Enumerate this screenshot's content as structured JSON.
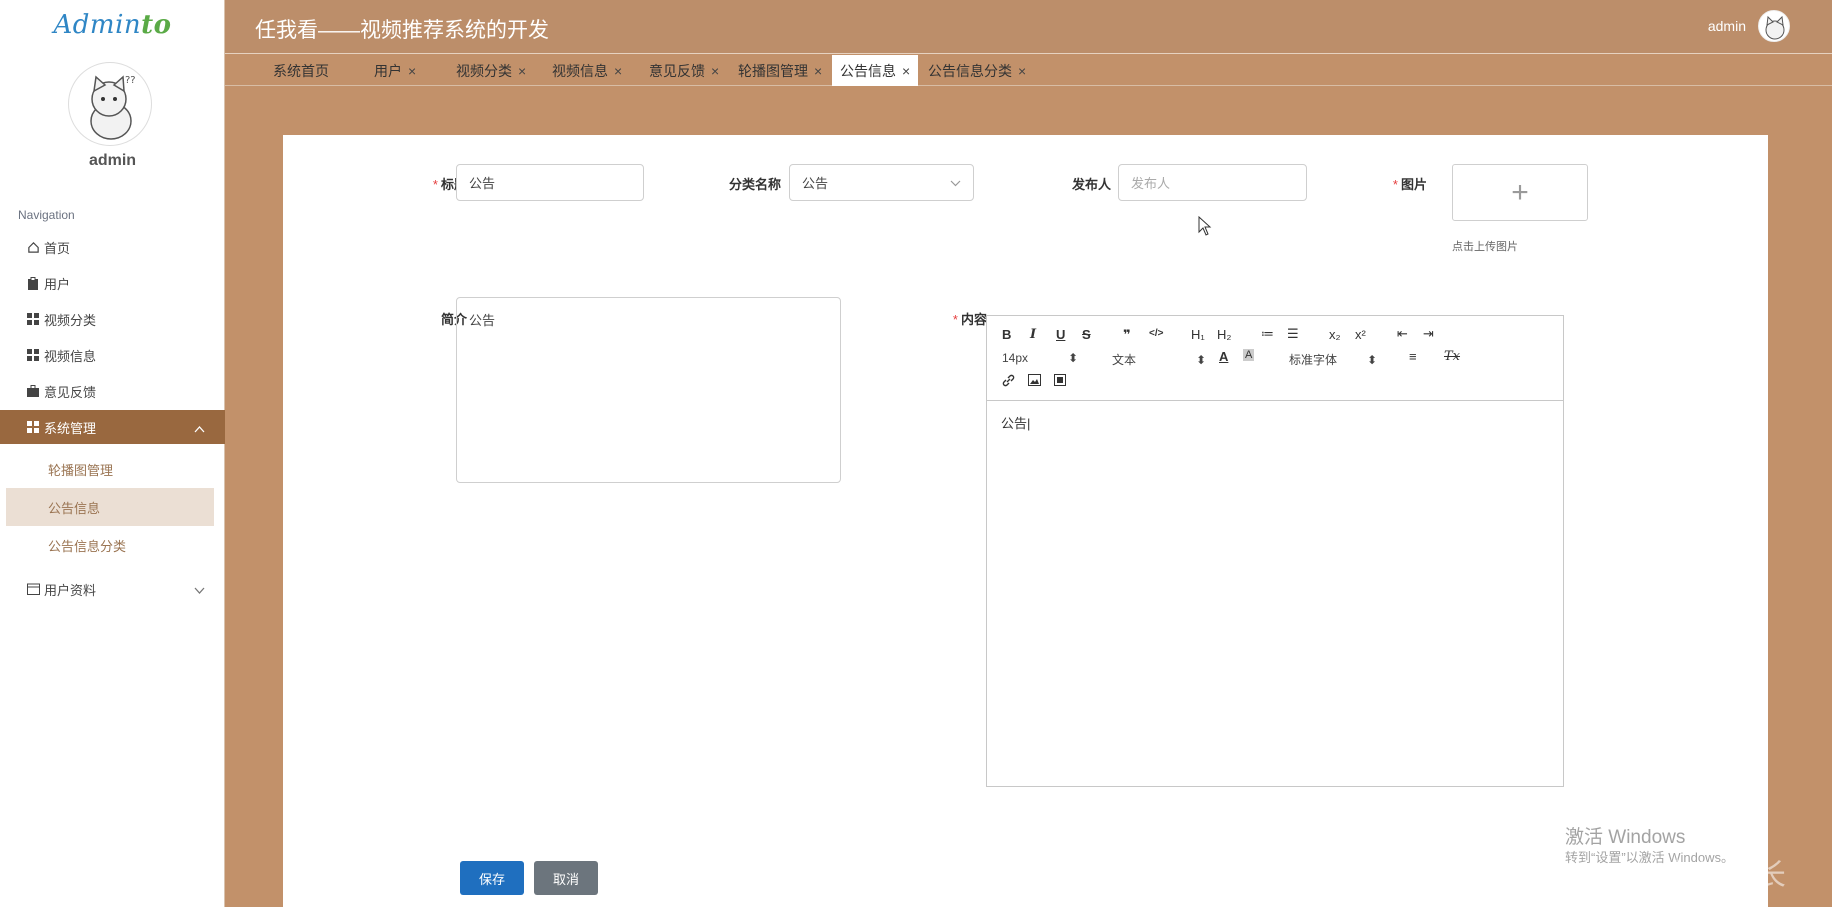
{
  "sidebar": {
    "logo_a": "Admin",
    "logo_b": "to",
    "profile_name": "admin",
    "nav_heading": "Navigation",
    "items": [
      {
        "label": "首页",
        "icon": "home-icon"
      },
      {
        "label": "用户",
        "icon": "clipboard-icon"
      },
      {
        "label": "视频分类",
        "icon": "grid-icon"
      },
      {
        "label": "视频信息",
        "icon": "grid-icon"
      },
      {
        "label": "意见反馈",
        "icon": "briefcase-icon"
      },
      {
        "label": "系统管理",
        "icon": "grid-icon",
        "expanded": true
      },
      {
        "label": "用户资料",
        "icon": "calendar-icon",
        "expanded": false
      }
    ],
    "sub_items": [
      {
        "label": "轮播图管理"
      },
      {
        "label": "公告信息",
        "active": true
      },
      {
        "label": "公告信息分类"
      }
    ]
  },
  "header": {
    "title": "任我看——视频推荐系统的开发",
    "user": "admin"
  },
  "tabs": [
    {
      "label": "系统首页",
      "closable": false
    },
    {
      "label": "用户",
      "closable": true
    },
    {
      "label": "视频分类",
      "closable": true
    },
    {
      "label": "视频信息",
      "closable": true
    },
    {
      "label": "意见反馈",
      "closable": true
    },
    {
      "label": "轮播图管理",
      "closable": true
    },
    {
      "label": "公告信息",
      "closable": true,
      "active": true
    },
    {
      "label": "公告信息分类",
      "closable": true
    }
  ],
  "form": {
    "title_label": "标题",
    "title_value": "公告",
    "category_label": "分类名称",
    "category_value": "公告",
    "publisher_label": "发布人",
    "publisher_placeholder": "发布人",
    "image_label": "图片",
    "upload_plus": "+",
    "upload_hint": "点击上传图片",
    "summary_label": "简介",
    "summary_value": "公告",
    "content_label": "内容",
    "content_value": "公告|",
    "required_mark": "*"
  },
  "editor_toolbar": {
    "font_size": "14px",
    "block_format": "文本",
    "font_family": "标准字体",
    "buttons": {
      "bold": "B",
      "italic": "I",
      "underline": "U",
      "strike": "S",
      "quote": "❞",
      "code": "</>",
      "h1": "H₁",
      "h2": "H₂",
      "ordered_list": "≔",
      "bullet_list": "☰",
      "subscript": "x₂",
      "superscript": "x²",
      "outdent": "⇤",
      "indent": "⇥",
      "font_color": "A",
      "background": "A",
      "align": "≡",
      "clear": "Tx"
    }
  },
  "buttons": {
    "save": "保存",
    "cancel": "取消"
  },
  "watermark": {
    "activate": "激活 Windows",
    "activate_sub": "转到“设置”以激活 Windows。",
    "csdn": "CSDN @家林学长"
  },
  "colors": {
    "accent": "#99683f",
    "background": "#c2916a",
    "primary_button": "#1f6fbf",
    "secondary_button": "#6c757d"
  }
}
